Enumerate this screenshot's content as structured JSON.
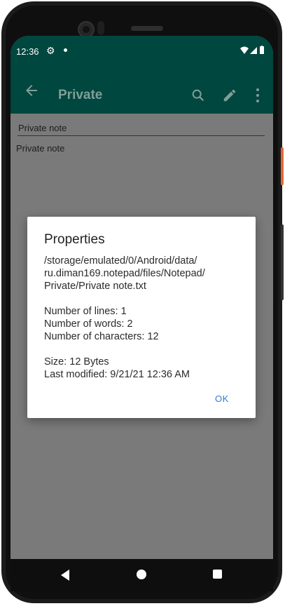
{
  "status_bar": {
    "time": "12:36"
  },
  "app_bar": {
    "title": "Private",
    "icons": [
      "back-arrow-icon",
      "search-icon",
      "edit-icon",
      "more-vert-icon"
    ]
  },
  "note": {
    "title": "Private note",
    "body": "Private note"
  },
  "dialog": {
    "title": "Properties",
    "path_lines": [
      "/storage/emulated/0/Android/data/",
      "ru.diman169.notepad/files/Notepad/",
      "Private/Private note.txt"
    ],
    "lines": "Number of lines: 1",
    "words": "Number of words: 2",
    "characters": "Number of characters: 12",
    "size": "Size: 12 Bytes",
    "modified": "Last modified: 9/21/21 12:36 AM",
    "ok_label": "OK"
  },
  "colors": {
    "primary_dark": "#00473f",
    "scrim_gray": "#7a7a7a",
    "accent": "#2e7bd8"
  }
}
